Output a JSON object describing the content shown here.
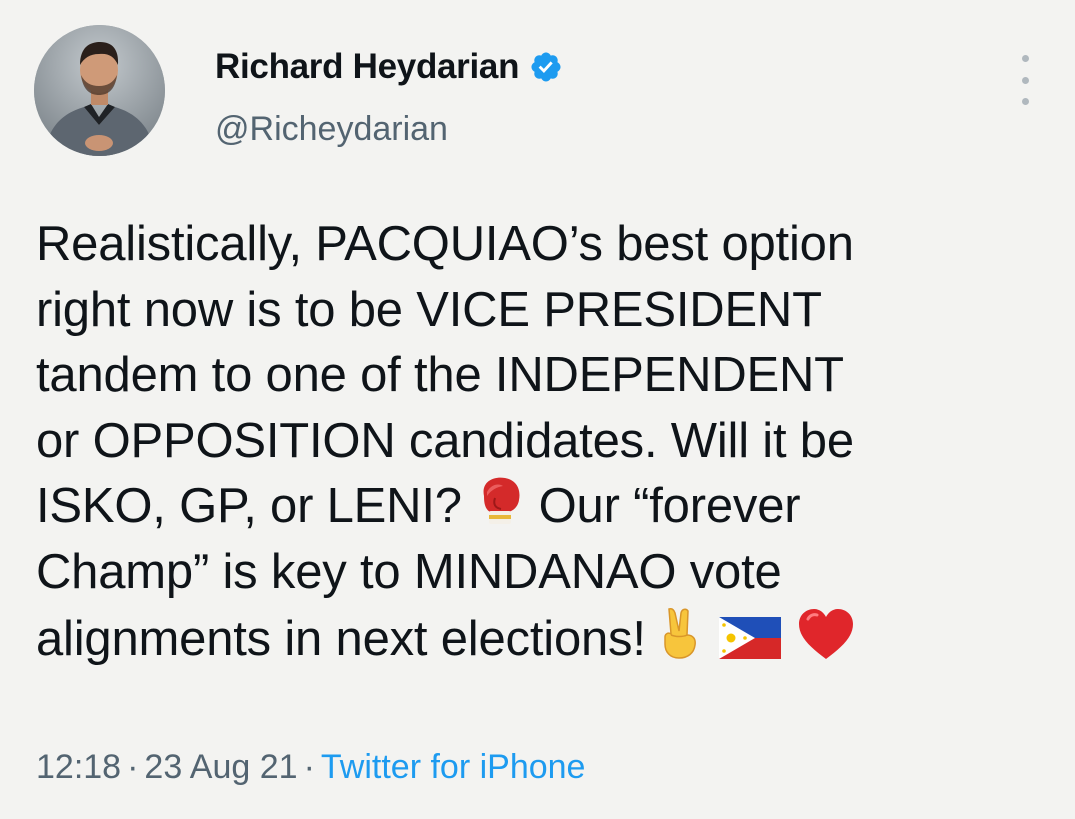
{
  "author": {
    "display_name": "Richard Heydarian",
    "handle": "@Richeydarian",
    "verified": true,
    "avatar_icon": "profile-photo"
  },
  "tweet": {
    "lines": [
      "Realistically, PACQUIAO’s best option",
      "right now is to be VICE PRESIDENT",
      "tandem to one of the INDEPENDENT",
      "or OPPOSITION candidates. Will it be"
    ],
    "line5_text_a": "ISKO, GP, or LENI?",
    "line5_text_b": "Our “forever",
    "line6": "Champ” is key to MINDANAO vote",
    "line7_text": "alignments in next elections!",
    "emojis": [
      "boxing-glove-icon",
      "victory-hand-icon",
      "philippines-flag-icon",
      "red-heart-icon"
    ]
  },
  "meta": {
    "time": "12:18",
    "date": "23 Aug 21",
    "separator": "·",
    "source": "Twitter for iPhone"
  },
  "colors": {
    "background": "#f3f3f1",
    "text": "#0f1419",
    "secondary": "#536471",
    "link": "#1d9bf0"
  }
}
